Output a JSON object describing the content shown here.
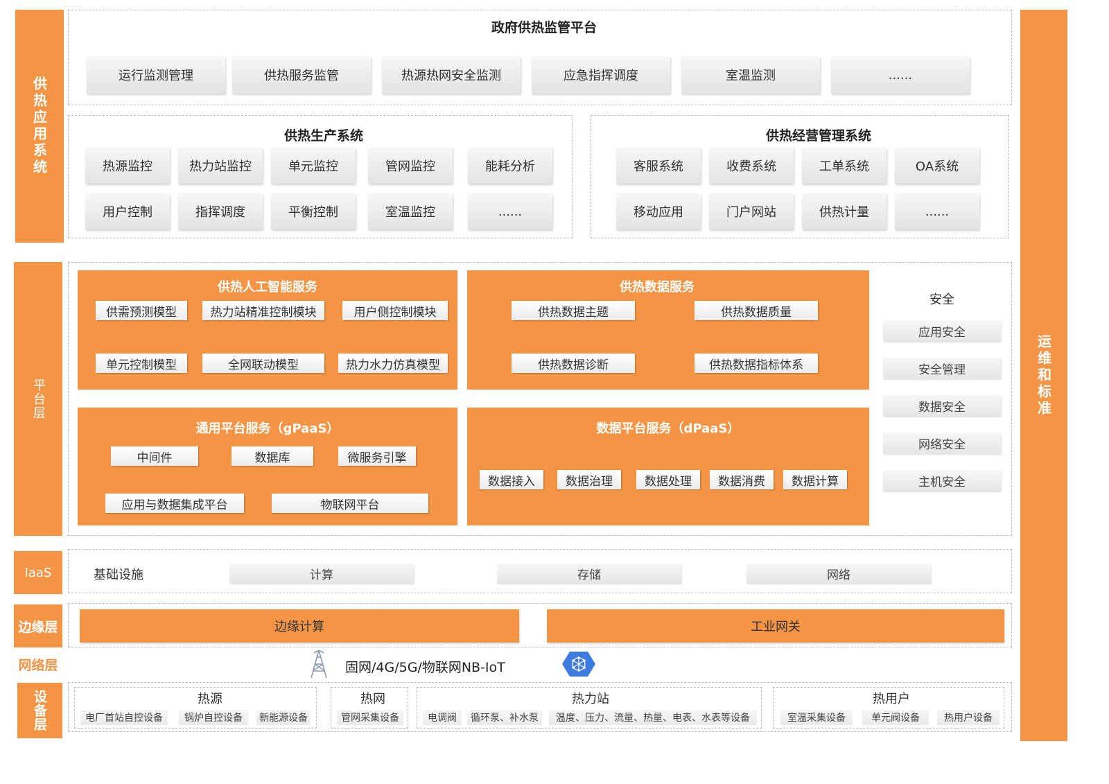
{
  "left_labels": {
    "app": "供热应用系统",
    "platform": "平台层",
    "iaas": "IaaS",
    "edge": "边缘层",
    "network": "网络层",
    "device": "设备层"
  },
  "right_label": "运维和标准",
  "gov": {
    "title": "政府供热监管平台",
    "items": [
      "运行监测管理",
      "供热服务监管",
      "热源热网安全监测",
      "应急指挥调度",
      "室温监测",
      "......"
    ]
  },
  "production": {
    "title": "供热生产系统",
    "row1": [
      "热源监控",
      "热力站监控",
      "单元监控",
      "管网监控",
      "能耗分析"
    ],
    "row2": [
      "用户控制",
      "指挥调度",
      "平衡控制",
      "室温监控",
      "......"
    ]
  },
  "management": {
    "title": "供热经营管理系统",
    "row1": [
      "客服系统",
      "收费系统",
      "工单系统",
      "OA系统"
    ],
    "row2": [
      "移动应用",
      "门户网站",
      "供热计量",
      "......"
    ]
  },
  "ai_service": {
    "title": "供热人工智能服务",
    "row1": [
      "供需预测模型",
      "热力站精准控制模块",
      "用户侧控制模块"
    ],
    "row2": [
      "单元控制模型",
      "全网联动模型",
      "热力水力仿真模型"
    ]
  },
  "data_service": {
    "title": "供热数据服务",
    "row1": [
      "供热数据主题",
      "供热数据质量"
    ],
    "row2": [
      "供热数据诊断",
      "供热数据指标体系"
    ]
  },
  "gpaas": {
    "title": "通用平台服务（gPaaS）",
    "row1": [
      "中间件",
      "数据库",
      "微服务引擎"
    ],
    "row2": [
      "应用与数据集成平台",
      "物联网平台"
    ]
  },
  "dpaas": {
    "title": "数据平台服务（dPaaS）",
    "items": [
      "数据接入",
      "数据治理",
      "数据处理",
      "数据消费",
      "数据计算"
    ]
  },
  "security": {
    "title": "安全",
    "items": [
      "应用安全",
      "安全管理",
      "数据安全",
      "网络安全",
      "主机安全"
    ]
  },
  "iaas": {
    "label": "基础设施",
    "items": [
      "计算",
      "存储",
      "网络"
    ]
  },
  "edge": {
    "items": [
      "边缘计算",
      "工业网关"
    ]
  },
  "network": {
    "text": "固网/4G/5G/物联网NB-IoT",
    "icons": [
      "tower-icon",
      "network-hub-icon"
    ]
  },
  "devices": {
    "groups": [
      {
        "title": "热源",
        "items": [
          "电厂首站自控设备",
          "锅炉自控设备",
          "新能源设备"
        ]
      },
      {
        "title": "热网",
        "items": [
          "管网采集设备"
        ]
      },
      {
        "title": "热力站",
        "items": [
          "电调阀",
          "循环泵、补水泵",
          "温度、压力、流量、热量、电表、水表等设备"
        ]
      },
      {
        "title": "热用户",
        "items": [
          "室温采集设备",
          "单元阀设备",
          "热用户设备"
        ]
      }
    ]
  },
  "colors": {
    "orange": "#f39545",
    "blue": "#3d7be0"
  }
}
